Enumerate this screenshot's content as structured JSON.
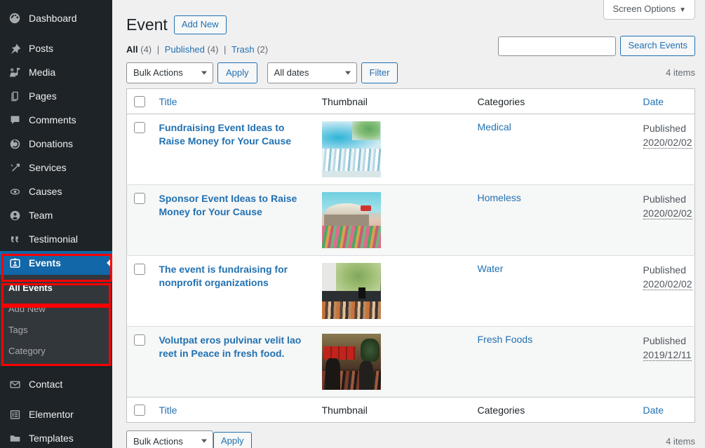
{
  "sidebar": {
    "items": [
      {
        "label": "Dashboard",
        "icon": "dashboard-icon"
      },
      {
        "label": "Posts",
        "icon": "pin-icon"
      },
      {
        "label": "Media",
        "icon": "media-icon"
      },
      {
        "label": "Pages",
        "icon": "pages-icon"
      },
      {
        "label": "Comments",
        "icon": "comments-icon"
      },
      {
        "label": "Donations",
        "icon": "donations-icon"
      },
      {
        "label": "Services",
        "icon": "services-icon"
      },
      {
        "label": "Causes",
        "icon": "causes-icon"
      },
      {
        "label": "Team",
        "icon": "team-icon"
      },
      {
        "label": "Testimonial",
        "icon": "quote-icon"
      },
      {
        "label": "Events",
        "icon": "events-icon"
      },
      {
        "label": "Contact",
        "icon": "envelope-icon"
      },
      {
        "label": "Elementor",
        "icon": "elementor-icon"
      },
      {
        "label": "Templates",
        "icon": "folder-icon"
      }
    ],
    "current": "Events",
    "submenu": [
      {
        "label": "All Events",
        "current": true
      },
      {
        "label": "Add New",
        "current": false
      },
      {
        "label": "Tags",
        "current": false
      },
      {
        "label": "Category",
        "current": false
      }
    ]
  },
  "screen_options": {
    "label": "Screen Options",
    "caret": "▼"
  },
  "header": {
    "title": "Event",
    "add_new": "Add New"
  },
  "search": {
    "value": "",
    "placeholder": "",
    "button": "Search Events"
  },
  "filters": [
    {
      "label": "All",
      "count": "(4)",
      "current": true
    },
    {
      "label": "Published",
      "count": "(4)",
      "current": false
    },
    {
      "label": "Trash",
      "count": "(2)",
      "current": false
    }
  ],
  "filter_divider": "|",
  "tablenav_top": {
    "bulk_actions": "Bulk Actions",
    "apply": "Apply",
    "dates": "All dates",
    "filter": "Filter",
    "displaying": "4 items"
  },
  "tablenav_bottom": {
    "bulk_actions": "Bulk Actions",
    "apply": "Apply",
    "displaying": "4 items"
  },
  "table": {
    "columns": {
      "title": "Title",
      "thumbnail": "Thumbnail",
      "categories": "Categories",
      "date": "Date"
    },
    "rows": [
      {
        "title": "Fundraising Event Ideas to Raise Money for Your Cause",
        "category": "Medical",
        "status": "Published",
        "date": "2020/02/02",
        "thumb": "holi-color-crowd"
      },
      {
        "title": "Sponsor Event Ideas to Raise Money for Your Cause",
        "category": "Homeless",
        "status": "Published",
        "date": "2020/02/02",
        "thumb": "festival-stage-crowd"
      },
      {
        "title": "The event is fundraising for nonprofit organizations",
        "category": "Water",
        "status": "Published",
        "date": "2020/02/02",
        "thumb": "outdoor-concert-stage"
      },
      {
        "title": "Volutpat eros pulvinar velit lao reet in Peace in fresh food.",
        "category": "Fresh Foods",
        "status": "Published",
        "date": "2019/12/11",
        "thumb": "battle-event-stage"
      }
    ]
  },
  "colors": {
    "sidebar_bg": "#1d2327",
    "submenu_bg": "#32373c",
    "current_blue": "#1167a8",
    "link_blue": "#2271b1",
    "annotation_red": "#fe0000"
  }
}
